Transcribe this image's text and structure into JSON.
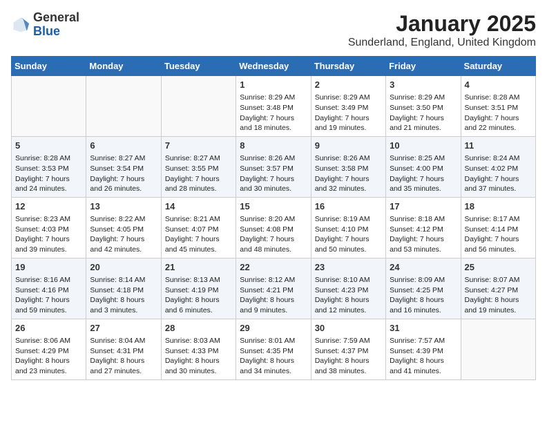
{
  "header": {
    "logo": {
      "line1": "General",
      "line2": "Blue"
    },
    "title": "January 2025",
    "subtitle": "Sunderland, England, United Kingdom"
  },
  "weekdays": [
    "Sunday",
    "Monday",
    "Tuesday",
    "Wednesday",
    "Thursday",
    "Friday",
    "Saturday"
  ],
  "weeks": [
    [
      {
        "day": "",
        "info": ""
      },
      {
        "day": "",
        "info": ""
      },
      {
        "day": "",
        "info": ""
      },
      {
        "day": "1",
        "info": "Sunrise: 8:29 AM\nSunset: 3:48 PM\nDaylight: 7 hours\nand 18 minutes."
      },
      {
        "day": "2",
        "info": "Sunrise: 8:29 AM\nSunset: 3:49 PM\nDaylight: 7 hours\nand 19 minutes."
      },
      {
        "day": "3",
        "info": "Sunrise: 8:29 AM\nSunset: 3:50 PM\nDaylight: 7 hours\nand 21 minutes."
      },
      {
        "day": "4",
        "info": "Sunrise: 8:28 AM\nSunset: 3:51 PM\nDaylight: 7 hours\nand 22 minutes."
      }
    ],
    [
      {
        "day": "5",
        "info": "Sunrise: 8:28 AM\nSunset: 3:53 PM\nDaylight: 7 hours\nand 24 minutes."
      },
      {
        "day": "6",
        "info": "Sunrise: 8:27 AM\nSunset: 3:54 PM\nDaylight: 7 hours\nand 26 minutes."
      },
      {
        "day": "7",
        "info": "Sunrise: 8:27 AM\nSunset: 3:55 PM\nDaylight: 7 hours\nand 28 minutes."
      },
      {
        "day": "8",
        "info": "Sunrise: 8:26 AM\nSunset: 3:57 PM\nDaylight: 7 hours\nand 30 minutes."
      },
      {
        "day": "9",
        "info": "Sunrise: 8:26 AM\nSunset: 3:58 PM\nDaylight: 7 hours\nand 32 minutes."
      },
      {
        "day": "10",
        "info": "Sunrise: 8:25 AM\nSunset: 4:00 PM\nDaylight: 7 hours\nand 35 minutes."
      },
      {
        "day": "11",
        "info": "Sunrise: 8:24 AM\nSunset: 4:02 PM\nDaylight: 7 hours\nand 37 minutes."
      }
    ],
    [
      {
        "day": "12",
        "info": "Sunrise: 8:23 AM\nSunset: 4:03 PM\nDaylight: 7 hours\nand 39 minutes."
      },
      {
        "day": "13",
        "info": "Sunrise: 8:22 AM\nSunset: 4:05 PM\nDaylight: 7 hours\nand 42 minutes."
      },
      {
        "day": "14",
        "info": "Sunrise: 8:21 AM\nSunset: 4:07 PM\nDaylight: 7 hours\nand 45 minutes."
      },
      {
        "day": "15",
        "info": "Sunrise: 8:20 AM\nSunset: 4:08 PM\nDaylight: 7 hours\nand 48 minutes."
      },
      {
        "day": "16",
        "info": "Sunrise: 8:19 AM\nSunset: 4:10 PM\nDaylight: 7 hours\nand 50 minutes."
      },
      {
        "day": "17",
        "info": "Sunrise: 8:18 AM\nSunset: 4:12 PM\nDaylight: 7 hours\nand 53 minutes."
      },
      {
        "day": "18",
        "info": "Sunrise: 8:17 AM\nSunset: 4:14 PM\nDaylight: 7 hours\nand 56 minutes."
      }
    ],
    [
      {
        "day": "19",
        "info": "Sunrise: 8:16 AM\nSunset: 4:16 PM\nDaylight: 7 hours\nand 59 minutes."
      },
      {
        "day": "20",
        "info": "Sunrise: 8:14 AM\nSunset: 4:18 PM\nDaylight: 8 hours\nand 3 minutes."
      },
      {
        "day": "21",
        "info": "Sunrise: 8:13 AM\nSunset: 4:19 PM\nDaylight: 8 hours\nand 6 minutes."
      },
      {
        "day": "22",
        "info": "Sunrise: 8:12 AM\nSunset: 4:21 PM\nDaylight: 8 hours\nand 9 minutes."
      },
      {
        "day": "23",
        "info": "Sunrise: 8:10 AM\nSunset: 4:23 PM\nDaylight: 8 hours\nand 12 minutes."
      },
      {
        "day": "24",
        "info": "Sunrise: 8:09 AM\nSunset: 4:25 PM\nDaylight: 8 hours\nand 16 minutes."
      },
      {
        "day": "25",
        "info": "Sunrise: 8:07 AM\nSunset: 4:27 PM\nDaylight: 8 hours\nand 19 minutes."
      }
    ],
    [
      {
        "day": "26",
        "info": "Sunrise: 8:06 AM\nSunset: 4:29 PM\nDaylight: 8 hours\nand 23 minutes."
      },
      {
        "day": "27",
        "info": "Sunrise: 8:04 AM\nSunset: 4:31 PM\nDaylight: 8 hours\nand 27 minutes."
      },
      {
        "day": "28",
        "info": "Sunrise: 8:03 AM\nSunset: 4:33 PM\nDaylight: 8 hours\nand 30 minutes."
      },
      {
        "day": "29",
        "info": "Sunrise: 8:01 AM\nSunset: 4:35 PM\nDaylight: 8 hours\nand 34 minutes."
      },
      {
        "day": "30",
        "info": "Sunrise: 7:59 AM\nSunset: 4:37 PM\nDaylight: 8 hours\nand 38 minutes."
      },
      {
        "day": "31",
        "info": "Sunrise: 7:57 AM\nSunset: 4:39 PM\nDaylight: 8 hours\nand 41 minutes."
      },
      {
        "day": "",
        "info": ""
      }
    ]
  ]
}
